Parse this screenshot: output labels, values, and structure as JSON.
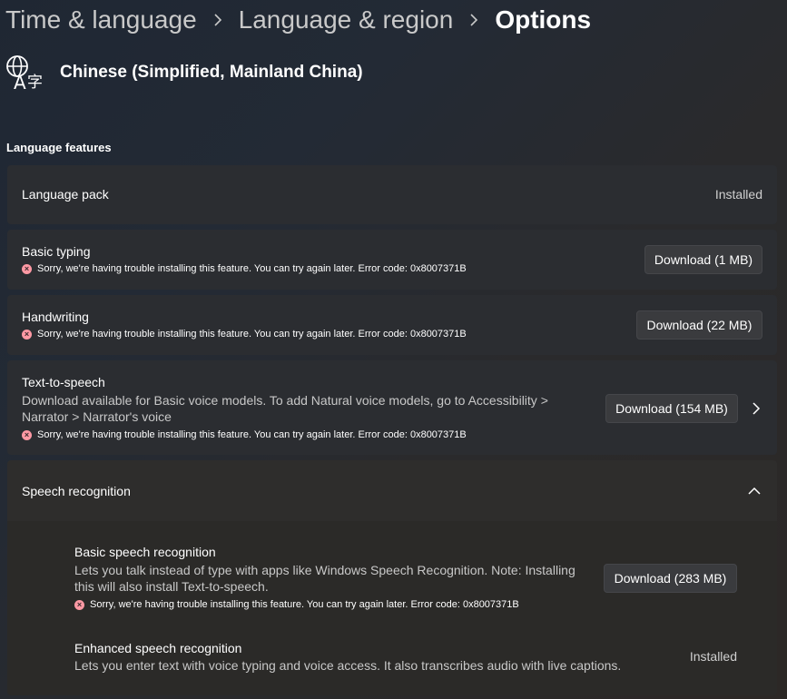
{
  "breadcrumb": {
    "items": [
      "Time & language",
      "Language & region",
      "Options"
    ]
  },
  "language": {
    "name": "Chinese (Simplified, Mainland China)",
    "icon": "language-icon"
  },
  "section": {
    "label": "Language features"
  },
  "features": {
    "language_pack": {
      "title": "Language pack",
      "status": "Installed"
    },
    "basic_typing": {
      "title": "Basic typing",
      "error": "Sorry, we're having trouble installing this feature. You can try again later. Error code: 0x8007371B",
      "button": "Download (1 MB)"
    },
    "handwriting": {
      "title": "Handwriting",
      "error": "Sorry, we're having trouble installing this feature. You can try again later. Error code: 0x8007371B",
      "button": "Download (22 MB)"
    },
    "tts": {
      "title": "Text-to-speech",
      "desc_line1": "Download available for Basic voice models. To add Natural voice models, go to Accessibility >",
      "desc_line2": "Narrator > Narrator's voice",
      "error": "Sorry, we're having trouble installing this feature. You can try again later. Error code: 0x8007371B",
      "button": "Download (154 MB)"
    },
    "speech": {
      "title": "Speech recognition",
      "basic": {
        "title": "Basic speech recognition",
        "desc_line1": "Lets you talk instead of type with apps like Windows Speech Recognition. Note: Installing",
        "desc_line2": "this will also install Text-to-speech.",
        "error": "Sorry, we're having trouble installing this feature. You can try again later. Error code: 0x8007371B",
        "button": "Download (283 MB)"
      },
      "enhanced": {
        "title": "Enhanced speech recognition",
        "desc": "Lets you enter text with voice typing and voice access. It also transcribes audio with live captions.",
        "status": "Installed"
      }
    }
  },
  "colors": {
    "error_icon": "#ff99a4",
    "card_bg": "#2b2d31",
    "button_bg": "#3a3b3e"
  }
}
